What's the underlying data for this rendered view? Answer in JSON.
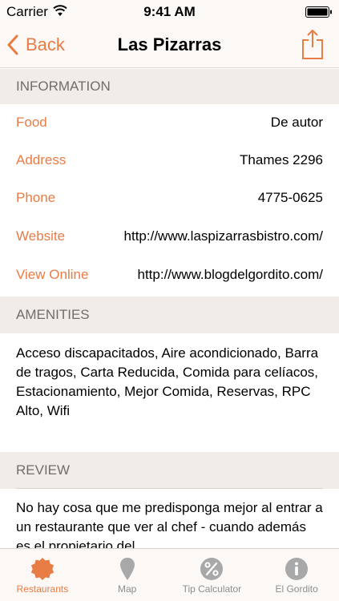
{
  "status_bar": {
    "carrier": "Carrier",
    "time": "9:41 AM"
  },
  "nav": {
    "back_label": "Back",
    "title": "Las Pizarras"
  },
  "information": {
    "header": "INFORMATION",
    "rows": [
      {
        "label": "Food",
        "value": "De autor"
      },
      {
        "label": "Address",
        "value": "Thames 2296"
      },
      {
        "label": "Phone",
        "value": "4775-0625"
      },
      {
        "label": "Website",
        "value": "http://www.laspizarrasbistro.com/"
      },
      {
        "label": "View Online",
        "value": "http://www.blogdelgordito.com/"
      }
    ]
  },
  "amenities": {
    "header": "AMENITIES",
    "text": "Acceso discapacitados, Aire acondicionado, Barra de tragos, Carta Reducida, Comida para celíacos, Estacionamiento, Mejor Comida, Reservas, RPC Alto, Wifi"
  },
  "review": {
    "header": "REVIEW",
    "text": "No hay cosa que me predisponga mejor al entrar a un restaurante que ver al chef - cuando además es el propietario del"
  },
  "tabs": [
    {
      "label": "Restaurants",
      "icon": "restaurant-icon"
    },
    {
      "label": "Map",
      "icon": "map-pin-icon"
    },
    {
      "label": "Tip Calculator",
      "icon": "percent-icon"
    },
    {
      "label": "El Gordito",
      "icon": "info-icon"
    }
  ],
  "colors": {
    "accent": "#e87c45",
    "section_bg": "#f2ece8",
    "bar_bg": "#fbf8f6"
  }
}
